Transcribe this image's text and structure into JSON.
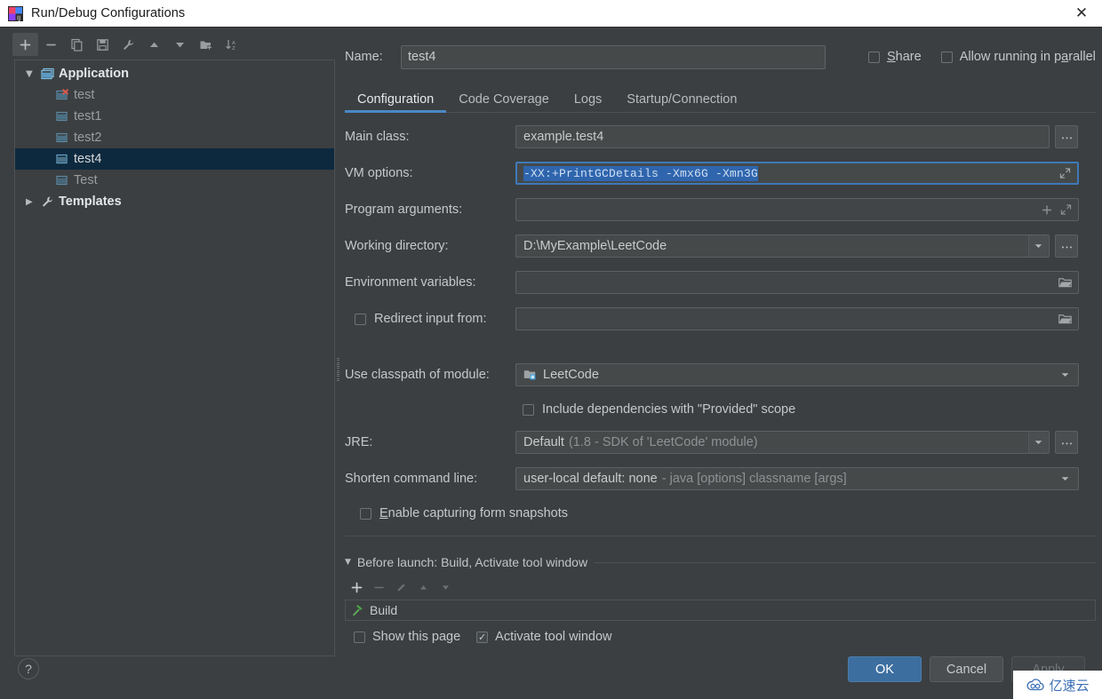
{
  "window": {
    "title": "Run/Debug Configurations",
    "app_icon": "intellij-idea-icon",
    "close_icon": "close-icon"
  },
  "colors": {
    "background": "#3c3f41",
    "field_background": "#45494a",
    "accent_blue": "#4a88c7",
    "selection_blue": "#2f65ad",
    "tree_selection": "#0d293e",
    "ok_button": "#3c6ea0",
    "build_green": "#4caf50"
  },
  "left_panel": {
    "toolbar": [
      {
        "name": "add-configuration-button",
        "icon": "plus-icon",
        "active": true
      },
      {
        "name": "remove-configuration-button",
        "icon": "minus-icon",
        "active": false
      },
      {
        "name": "copy-configuration-button",
        "icon": "copy-icon",
        "active": false
      },
      {
        "name": "save-configuration-button",
        "icon": "save-icon",
        "active": false
      },
      {
        "name": "edit-templates-button",
        "icon": "wrench-icon",
        "active": false
      },
      {
        "name": "move-up-button",
        "icon": "arrow-up-icon",
        "active": false
      },
      {
        "name": "move-down-button",
        "icon": "arrow-down-icon",
        "active": false
      },
      {
        "name": "new-folder-button",
        "icon": "new-folder-icon",
        "active": false
      },
      {
        "name": "sort-configurations-button",
        "icon": "sort-alpha-icon",
        "active": false
      }
    ],
    "tree": [
      {
        "label": "Application",
        "type": "group",
        "expanded": true,
        "icon": "application-icon",
        "selected": false
      },
      {
        "label": "test",
        "type": "child",
        "icon": "run-config-error-icon",
        "selected": false
      },
      {
        "label": "test1",
        "type": "child",
        "icon": "run-config-icon",
        "selected": false
      },
      {
        "label": "test2",
        "type": "child",
        "icon": "run-config-icon",
        "selected": false
      },
      {
        "label": "test4",
        "type": "child",
        "icon": "run-config-icon",
        "selected": true
      },
      {
        "label": "Test",
        "type": "child",
        "icon": "run-config-icon",
        "selected": false
      },
      {
        "label": "Templates",
        "type": "group",
        "expanded": false,
        "icon": "wrench-icon",
        "selected": false
      }
    ]
  },
  "header": {
    "name_label": "Name:",
    "name_value": "test4",
    "share_label": "Share",
    "share_checked": false,
    "allow_parallel_label": "Allow running in parallel",
    "allow_parallel_checked": false
  },
  "tabs": [
    {
      "label": "Configuration",
      "active": true
    },
    {
      "label": "Code Coverage",
      "active": false
    },
    {
      "label": "Logs",
      "active": false
    },
    {
      "label": "Startup/Connection",
      "active": false
    }
  ],
  "form": {
    "main_class": {
      "label": "Main class:",
      "value": "example.test4",
      "browse_icon": "ellipsis-icon"
    },
    "vm_options": {
      "label": "VM options:",
      "value": "-XX:+PrintGCDetails -Xmx6G -Xmn3G",
      "selected": true,
      "focused": true,
      "expand_icon": "expand-diagonal-icon"
    },
    "program_arguments": {
      "label": "Program arguments:",
      "value": "",
      "add_icon": "plus-icon",
      "expand_icon": "expand-diagonal-icon"
    },
    "working_directory": {
      "label": "Working directory:",
      "value": "D:\\MyExample\\LeetCode",
      "dropdown_icon": "chevron-down-icon",
      "browse_icon": "ellipsis-icon"
    },
    "environment_variables": {
      "label": "Environment variables:",
      "value": "",
      "browse_icon": "folder-icon"
    },
    "redirect_input": {
      "label": "Redirect input from:",
      "checked": false,
      "value": "",
      "browse_icon": "folder-icon"
    },
    "use_classpath_of_module": {
      "label": "Use classpath of module:",
      "value": "LeetCode",
      "module_icon": "module-icon",
      "dropdown_icon": "chevron-down-icon"
    },
    "include_dependencies": {
      "label": "Include dependencies with \"Provided\" scope",
      "checked": false
    },
    "jre": {
      "label": "JRE:",
      "value": "Default",
      "value_suffix": "(1.8 - SDK of 'LeetCode' module)",
      "dropdown_icon": "chevron-down-icon",
      "browse_icon": "ellipsis-icon"
    },
    "shorten_command_line": {
      "label": "Shorten command line:",
      "value": "user-local default: none",
      "value_suffix": "- java [options] classname [args]",
      "dropdown_icon": "chevron-down-icon"
    },
    "enable_capturing": {
      "label": "Enable capturing form snapshots",
      "checked": false
    }
  },
  "before_launch": {
    "title": "Before launch: Build, Activate tool window",
    "collapse_icon": "triangle-down-icon",
    "toolbar": [
      {
        "name": "add-task-button",
        "icon": "plus-icon",
        "enabled": true
      },
      {
        "name": "remove-task-button",
        "icon": "minus-icon",
        "enabled": false
      },
      {
        "name": "edit-task-button",
        "icon": "pencil-icon",
        "enabled": false
      },
      {
        "name": "move-task-up-button",
        "icon": "arrow-up-icon",
        "enabled": false
      },
      {
        "name": "move-task-down-button",
        "icon": "arrow-down-icon",
        "enabled": false
      }
    ],
    "items": [
      {
        "label": "Build",
        "icon": "build-hammer-icon"
      }
    ],
    "show_this_page": {
      "label": "Show this page",
      "checked": false
    },
    "activate_tool_window": {
      "label": "Activate tool window",
      "checked": true
    }
  },
  "footer": {
    "help_icon": "question-mark-icon",
    "ok_label": "OK",
    "cancel_label": "Cancel",
    "apply_label": "Apply",
    "apply_enabled": false
  },
  "watermark": {
    "text": "亿速云",
    "icon": "cloud-spiral-icon"
  }
}
